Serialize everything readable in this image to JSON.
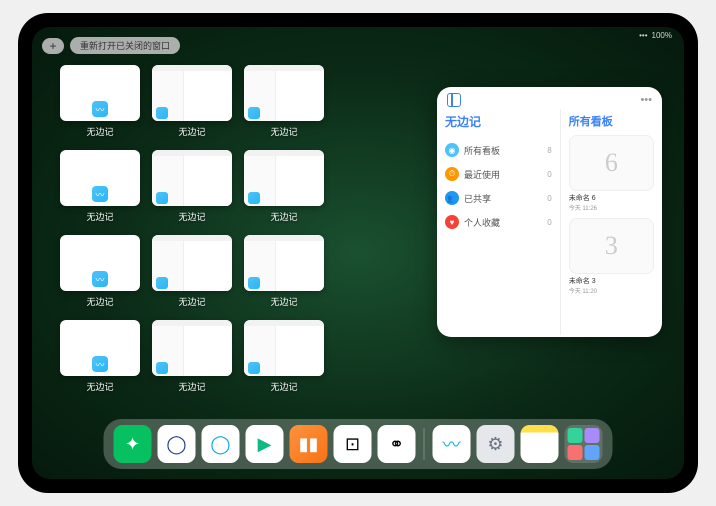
{
  "statusbar": {
    "signal": "•••",
    "battery": "100%"
  },
  "topbar": {
    "plus_label": "+",
    "reopen_label": "重新打开已关闭的窗口"
  },
  "app_grid": {
    "label": "无边记",
    "cards": [
      {
        "type": "blank"
      },
      {
        "type": "detail"
      },
      {
        "type": "detail"
      },
      null,
      {
        "type": "blank"
      },
      {
        "type": "detail"
      },
      {
        "type": "detail"
      },
      null,
      {
        "type": "blank"
      },
      {
        "type": "detail"
      },
      {
        "type": "detail"
      },
      null,
      {
        "type": "blank"
      },
      {
        "type": "detail"
      },
      {
        "type": "detail"
      },
      null
    ]
  },
  "panel": {
    "more": "•••",
    "left_title": "无边记",
    "right_title": "所有看板",
    "sidebar": [
      {
        "icon_bg": "#4FC3F7",
        "glyph": "◉",
        "label": "所有看板",
        "count": "8"
      },
      {
        "icon_bg": "#FF9800",
        "glyph": "⏱",
        "label": "最近使用",
        "count": "0"
      },
      {
        "icon_bg": "#2196F3",
        "glyph": "👥",
        "label": "已共享",
        "count": "0"
      },
      {
        "icon_bg": "#F44336",
        "glyph": "♥",
        "label": "个人收藏",
        "count": "0"
      }
    ],
    "boards": [
      {
        "sketch": "6",
        "title": "未命名 6",
        "subtitle": "今天 11:26"
      },
      {
        "sketch": "3",
        "title": "未命名 3",
        "subtitle": "今天 11:20"
      }
    ]
  },
  "dock": {
    "apps": [
      {
        "name": "wechat",
        "bg": "#07C160",
        "glyph": "✦"
      },
      {
        "name": "quark1",
        "bg": "#FFFFFF",
        "glyph": "◯",
        "color": "#1E3A8A"
      },
      {
        "name": "quark2",
        "bg": "#FFFFFF",
        "glyph": "◯",
        "color": "#0EA5E9"
      },
      {
        "name": "video",
        "bg": "#FFFFFF",
        "glyph": "▶",
        "color": "#10B981"
      },
      {
        "name": "books",
        "bg": "linear-gradient(135deg,#FB923C,#F97316)",
        "glyph": "▮▮",
        "color": "#fff"
      },
      {
        "name": "dice",
        "bg": "#FFFFFF",
        "glyph": "⊡",
        "color": "#000"
      },
      {
        "name": "connect",
        "bg": "#FFFFFF",
        "glyph": "⚭",
        "color": "#000"
      }
    ],
    "recent": [
      {
        "name": "freeform",
        "bg": "#FFFFFF",
        "glyph": "〰",
        "color": "#06B6D4"
      },
      {
        "name": "settings",
        "bg": "#E5E7EB",
        "glyph": "⚙",
        "color": "#6B7280"
      },
      {
        "name": "notes",
        "bg": "linear-gradient(#FDE047 20%,#FFFFFF 20%)",
        "glyph": "",
        "color": ""
      }
    ],
    "tray": [
      "#34D399",
      "#A78BFA",
      "#F87171",
      "#60A5FA"
    ]
  }
}
